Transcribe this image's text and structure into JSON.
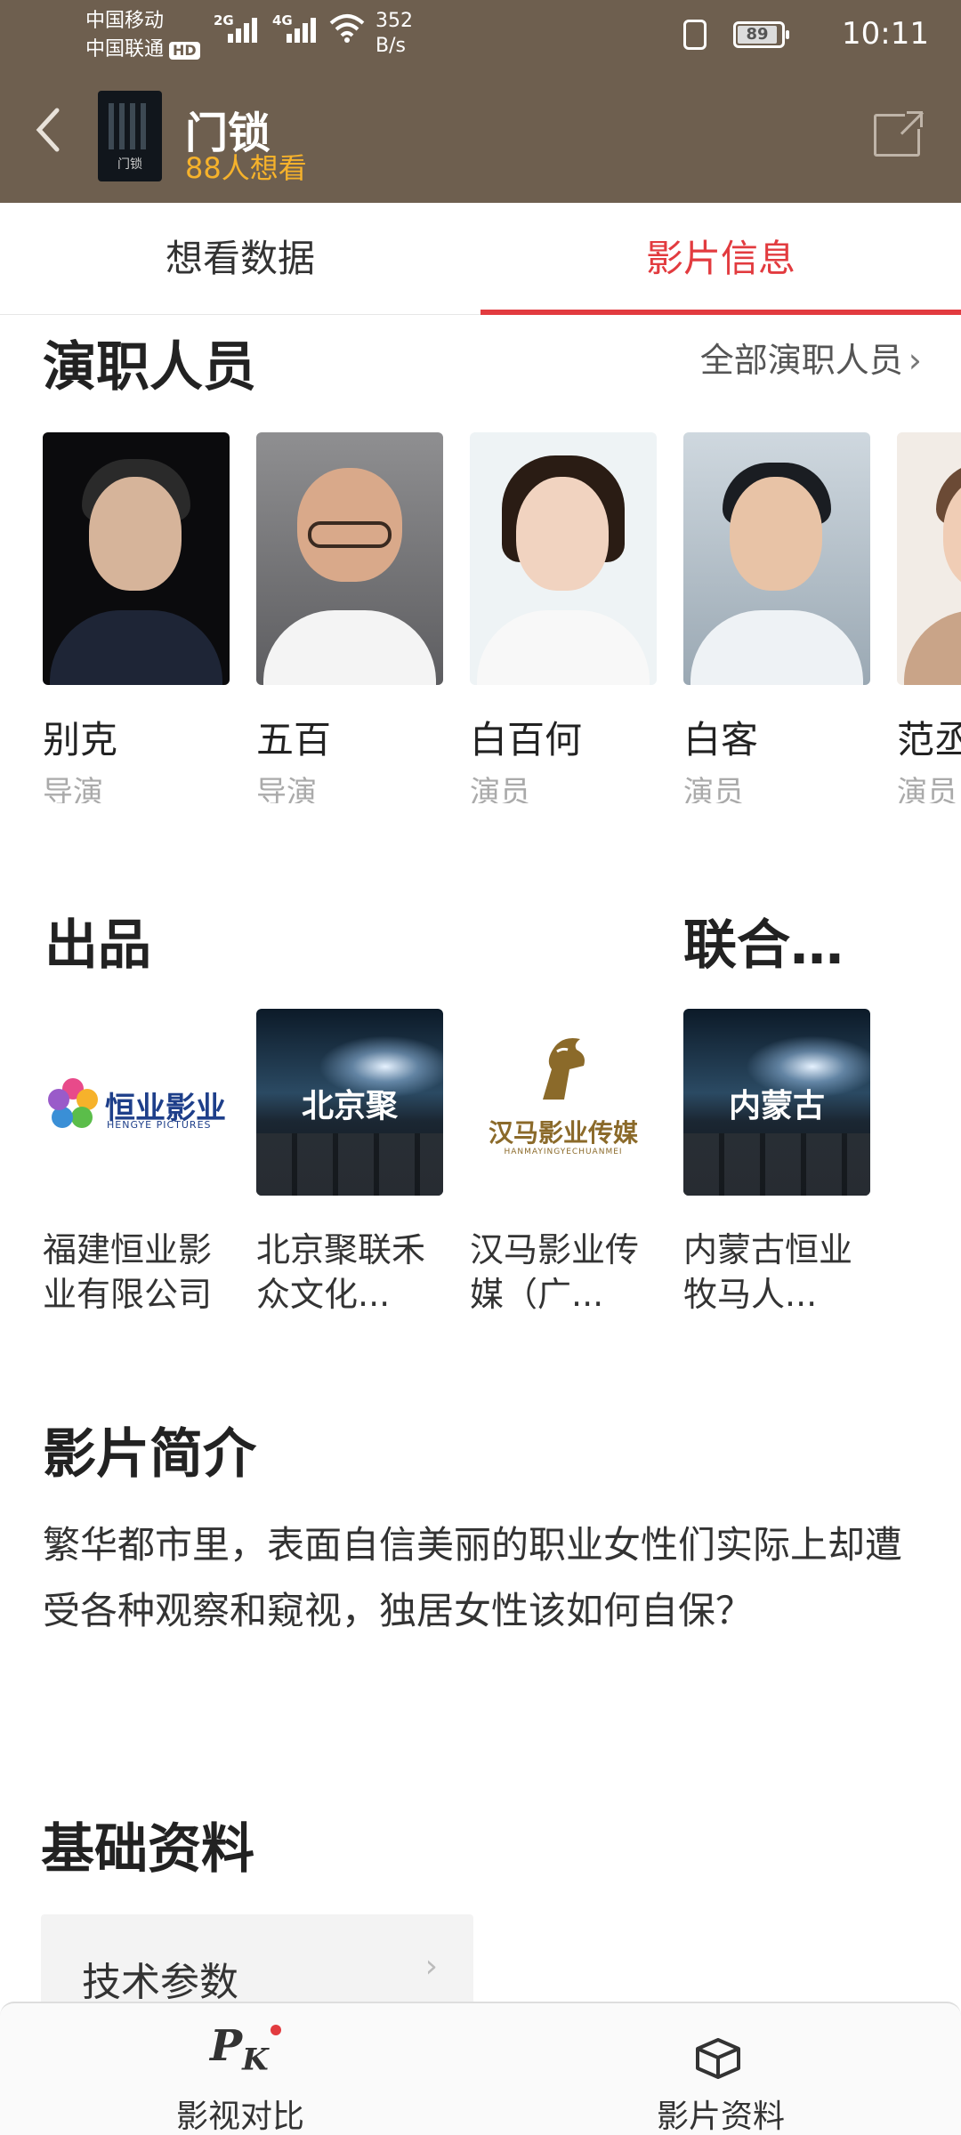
{
  "status_bar": {
    "carrier1": "中国移动",
    "carrier2": "中国联通",
    "hd": "HD",
    "net1": "2G",
    "net2": "4G",
    "speed": "352",
    "speed_unit": "B/s",
    "battery": "89",
    "time": "10:11"
  },
  "header": {
    "title": "门锁",
    "want_count": "88人想看",
    "poster_text": "门锁"
  },
  "tabs": [
    {
      "label": "想看数据",
      "active": false
    },
    {
      "label": "影片信息",
      "active": true
    }
  ],
  "cast_section": {
    "title": "演职人员",
    "all_link": "全部演职人员",
    "people": [
      {
        "name": "别克",
        "role": "导演"
      },
      {
        "name": "五百",
        "role": "导演"
      },
      {
        "name": "白百何",
        "role": "演员"
      },
      {
        "name": "白客",
        "role": "演员"
      },
      {
        "name": "范丞",
        "role": "演员"
      }
    ]
  },
  "production_section": {
    "title": "出品",
    "title2": "联合…",
    "companies": [
      {
        "name": "福建恒业影业有限公司",
        "logo_text": "恒业影业",
        "logo_sub": "HENGYE PICTURES"
      },
      {
        "name": "北京聚联禾众文化...",
        "logo_text": "北京聚"
      },
      {
        "name": "汉马影业传媒（广...",
        "logo_text": "汉马影业传媒",
        "logo_sub": "HANMAYINGYECHUANMEI"
      },
      {
        "name": "内蒙古恒业牧马人...",
        "logo_text": "内蒙古"
      }
    ]
  },
  "synopsis_section": {
    "title": "影片简介",
    "text": "繁华都市里，表面自信美丽的职业女性们实际上却遭受各种观察和窥视，独居女性该如何自保？"
  },
  "basic_section": {
    "title": "基础资料",
    "tech_label": "技术参数"
  },
  "bottom_bar": {
    "compare_label": "影视对比",
    "info_label": "影片资料"
  },
  "colors": {
    "header_bg": "#6e5f4f",
    "accent_red": "#e23b3f",
    "want_yellow": "#f6b22b"
  }
}
